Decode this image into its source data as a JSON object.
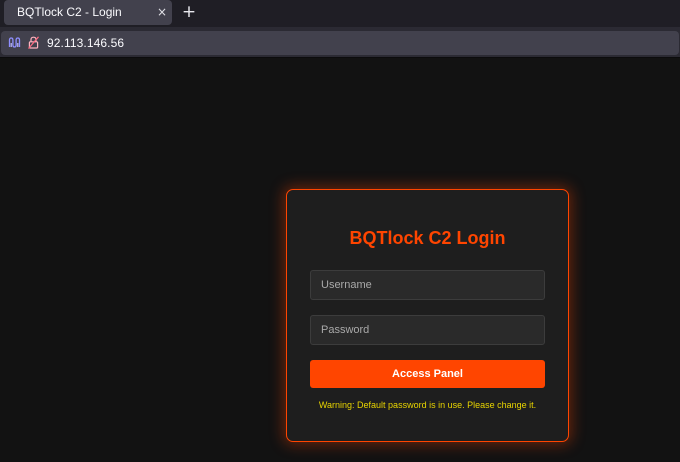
{
  "browser": {
    "tab": {
      "title": "BQTlock C2 - Login",
      "close_glyph": "×"
    },
    "new_tab_glyph": "+",
    "address_bar": {
      "url": "92.113.146.56"
    },
    "icons": {
      "tracking": "tracking-protection-icon",
      "lock": "insecure-lock-icon"
    }
  },
  "login": {
    "title": "BQTlock C2 Login",
    "username_placeholder": "Username",
    "password_placeholder": "Password",
    "submit_label": "Access Panel",
    "warning": "Warning: Default password is in use. Please change it."
  },
  "colors": {
    "accent": "#ff4500",
    "warning": "#e8d400",
    "page_background": "#121212",
    "card_background": "#1e1e1e"
  }
}
